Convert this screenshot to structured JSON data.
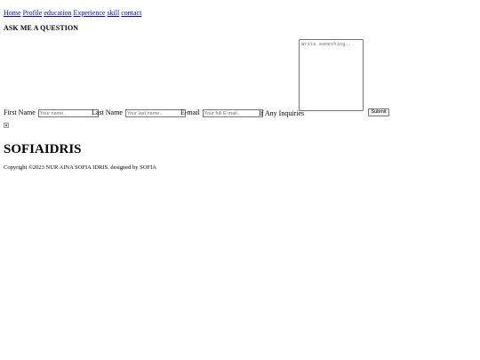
{
  "nav": {
    "items": [
      {
        "label": "Home"
      },
      {
        "label": "Profile"
      },
      {
        "label": "education"
      },
      {
        "label": "Experience"
      },
      {
        "label": "skill"
      },
      {
        "label": "contact"
      }
    ]
  },
  "contact": {
    "title": "ASK ME A QUESTION",
    "first_name": {
      "label": "First Name",
      "placeholder": "Your name.."
    },
    "last_name": {
      "label": "Last Name",
      "placeholder": "Your last name.."
    },
    "email": {
      "label": "E-mail",
      "placeholder": "Your full E-mail.."
    },
    "inquiries": {
      "label": "If Any Inquiries",
      "placeholder": "Write something.."
    },
    "submit_label": "Submit"
  },
  "footer": {
    "brand": "SOFIAIDRIS",
    "copyright": "Copyright ©2023 NUR AINA SOFIA IDRIS. designed by SOFIA"
  }
}
